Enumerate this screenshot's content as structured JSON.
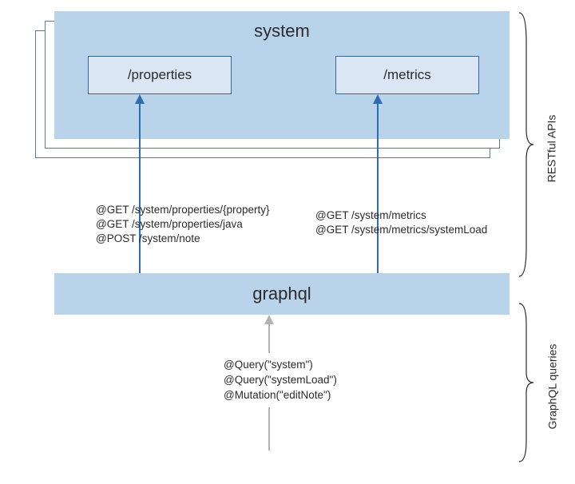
{
  "system": {
    "title": "system",
    "resources": {
      "properties": "/properties",
      "metrics": "/metrics"
    }
  },
  "restApis": {
    "left": "@GET /system/properties/{property}\n@GET /system/properties/java\n@POST /system/note",
    "right": "@GET /system/metrics\n@GET /system/metrics/systemLoad"
  },
  "graphql": {
    "title": "graphql",
    "queries": "@Query(\"system\")\n@Query(\"systemLoad\")\n@Mutation(\"editNote\")"
  },
  "labels": {
    "rest": "RESTful APIs",
    "gql": "GraphQL queries"
  }
}
